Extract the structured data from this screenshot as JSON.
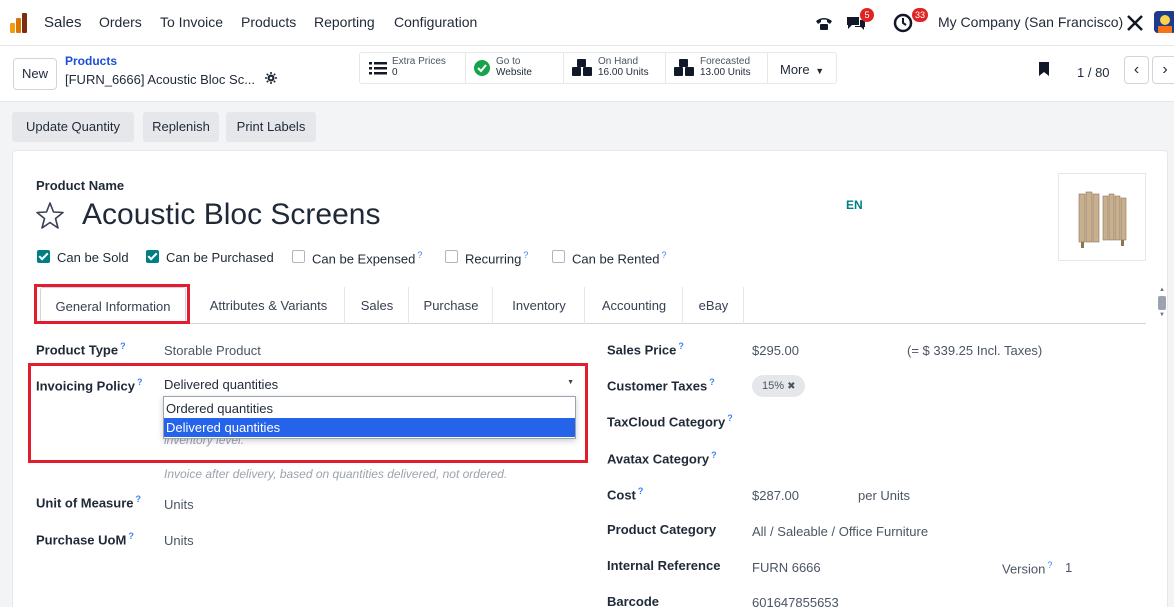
{
  "navbar": {
    "app_name": "Sales",
    "menu": [
      "Orders",
      "To Invoice",
      "Products",
      "Reporting",
      "Configuration"
    ],
    "messages_badge": "5",
    "activities_badge": "33",
    "company": "My Company (San Francisco)"
  },
  "control_panel": {
    "new_label": "New",
    "breadcrumb_parent": "Products",
    "breadcrumb_current": "[FURN_6666] Acoustic Bloc Sc...",
    "smart_buttons": [
      {
        "line1": "Extra Prices",
        "line2": "0"
      },
      {
        "line1": "Go to",
        "line2": "Website"
      },
      {
        "line1": "On Hand",
        "line2": "16.00 Units"
      },
      {
        "line1": "Forecasted",
        "line2": "13.00 Units"
      }
    ],
    "more_label": "More",
    "pager": "1 / 80"
  },
  "action_bar": {
    "buttons": [
      "Update Quantity",
      "Replenish",
      "Print Labels"
    ]
  },
  "form": {
    "product_name_label": "Product Name",
    "product_name": "Acoustic Bloc Screens",
    "lang": "EN",
    "checkboxes": [
      {
        "label": "Can be Sold",
        "checked": true
      },
      {
        "label": "Can be Purchased",
        "checked": true
      },
      {
        "label": "Can be Expensed",
        "checked": false
      },
      {
        "label": "Recurring",
        "checked": false
      },
      {
        "label": "Can be Rented",
        "checked": false
      }
    ],
    "tabs": [
      "General Information",
      "Attributes & Variants",
      "Sales",
      "Purchase",
      "Inventory",
      "Accounting",
      "eBay"
    ],
    "left": {
      "product_type_label": "Product Type",
      "product_type": "Storable Product",
      "invoicing_policy_label": "Invoicing Policy",
      "invoicing_policy": "Delivered quantities",
      "dropdown_options": [
        "Ordered quantities",
        "Delivered quantities"
      ],
      "hidden_hint": "inventory level.",
      "invoicing_help": "Invoice after delivery, based on quantities delivered, not ordered.",
      "uom_label": "Unit of Measure",
      "uom": "Units",
      "purchase_uom_label": "Purchase UoM",
      "purchase_uom": "Units"
    },
    "right": {
      "sales_price_label": "Sales Price",
      "sales_price": "$295.00",
      "incl_taxes": "(= $ 339.25 Incl. Taxes)",
      "customer_taxes_label": "Customer Taxes",
      "tax_tag": "15%",
      "taxcloud_label": "TaxCloud Category",
      "avatax_label": "Avatax Category",
      "cost_label": "Cost",
      "cost": "$287.00",
      "cost_unit": "per Units",
      "category_label": "Product Category",
      "category": "All / Saleable / Office Furniture",
      "internal_ref_label": "Internal Reference",
      "internal_ref": "FURN 6666",
      "version_label": "Version",
      "version": "1",
      "barcode_label": "Barcode",
      "barcode": "601647855653"
    }
  },
  "colors": {
    "accent": "#017e84",
    "highlight_box": "#e11d2e",
    "selected_option": "#2563eb",
    "link": "#1d4ed8"
  }
}
